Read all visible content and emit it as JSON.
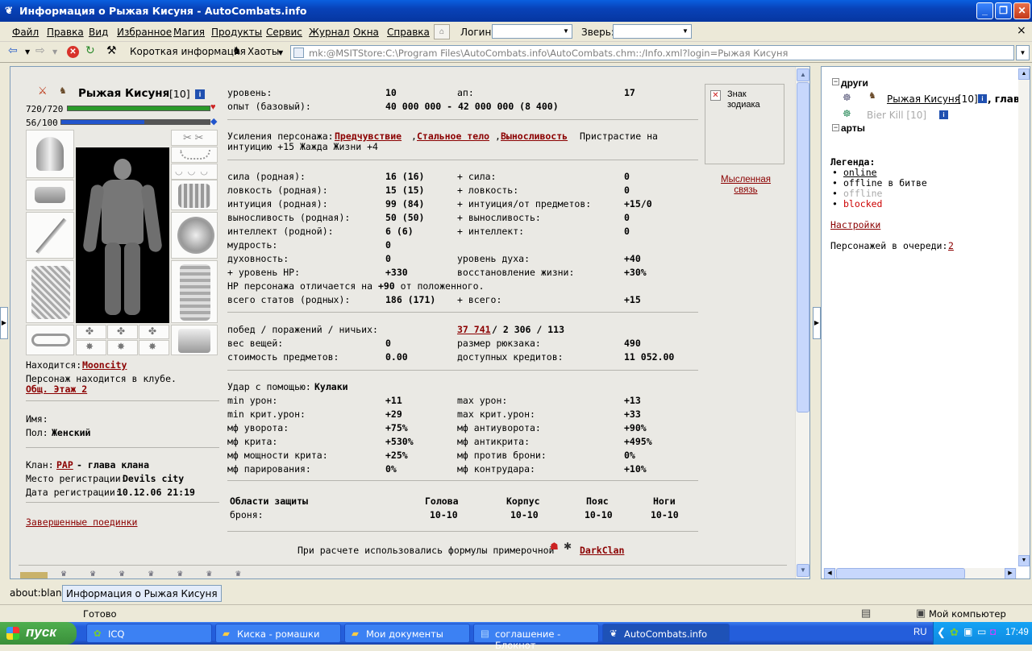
{
  "window": {
    "title": "Информация о Рыжая Кисуня - AutoCombats.info"
  },
  "menu": {
    "items": [
      "Файл",
      "Правка",
      "Вид",
      "Избранное",
      "Магия",
      "Продукты",
      "Сервис",
      "Журнал",
      "Окна",
      "Справка"
    ],
    "login_label": "Логин:",
    "beast_label": "Зверь:",
    "close": "×"
  },
  "toolbar": {
    "short_info": "Короткая информация",
    "chaos": "Хаоты"
  },
  "address": "mk:@MSITStore:C:\\Program Files\\AutoCombats.info\\AutoCombats.chm::/Info.xml?login=Рыжая Кисуня",
  "character": {
    "name": "Рыжая Кисуня",
    "level": "[10]",
    "hp": "720/720",
    "hp_fill": 1.0,
    "mana": "56/100",
    "mana_fill": 0.56,
    "location_label": "Находится:",
    "location": "Mooncity",
    "club_text": "Персонаж находится в клубе.",
    "club_link": "Общ. Этаж 2",
    "name_label": "Имя:",
    "gender_label": "Пол:",
    "gender": "Женский",
    "clan_label": "Клан:",
    "clan": "PAP",
    "clan_role": " - глава клана",
    "regplace_label": "Место регистрации:",
    "regplace": "Devils city",
    "regdate_label": "Дата регистрации:",
    "regdate": "10.12.06 21:19",
    "finished_battles": "Завершенные поединки"
  },
  "stats": {
    "level_label": "уровень:",
    "level": "10",
    "ap_label": "ап:",
    "ap": "17",
    "exp_label": "опыт (базовый):",
    "exp": "40 000 000 - 42 000 000 (8 400)",
    "boosts_label": "Усиления персонажа:",
    "boost1": "Предчувствие",
    "boost2": "Стальное тело",
    "boost3": "Выносливость",
    "boost_tail": "Пристрастие на",
    "boost_line2": "интуицию +15 Жажда Жизни +4",
    "rows": [
      {
        "l": "сила (родная):",
        "v": "16 (16)",
        "l2": "+ сила:",
        "v2": "0"
      },
      {
        "l": "ловкость (родная):",
        "v": "15 (15)",
        "l2": "+ ловкость:",
        "v2": "0"
      },
      {
        "l": "интуиция (родная):",
        "v": "99 (84)",
        "l2": "+ интуиция/от предметов:",
        "v2": "+15/0"
      },
      {
        "l": "выносливость (родная):",
        "v": "50 (50)",
        "l2": "+ выносливость:",
        "v2": "0"
      },
      {
        "l": "интеллект (родной):",
        "v": "6 (6)",
        "l2": "+ интеллект:",
        "v2": "0"
      },
      {
        "l": "мудрость:",
        "v": "0",
        "l2": "",
        "v2": ""
      },
      {
        "l": "духовность:",
        "v": "0",
        "l2": "уровень духа:",
        "v2": "+40"
      },
      {
        "l": "+ уровень HP:",
        "v": "+330",
        "l2": "восстановление жизни:",
        "v2": "+30%"
      }
    ],
    "hp_note_a": "HP персонажа отличается на",
    "hp_note_b": "+90",
    "hp_note_c": "от положенного.",
    "total_label": "всего статов (родных):",
    "total": "186 (171)",
    "total2_label": "+ всего:",
    "total2": "+15",
    "wins_label": "побед / поражений / ничьих:",
    "wins": "37 741",
    "wins_rest": " / 2 306 / 113",
    "weight_label": "вес вещей:",
    "weight": "0",
    "bag_label": "размер рюкзака:",
    "bag": "490",
    "cost_label": "стоимость предметов:",
    "cost": "0.00",
    "credits_label": "доступных кредитов:",
    "credits": "11 052.00",
    "strike_label": "Удар с помощью:",
    "strike": "Кулаки",
    "combat": [
      {
        "l": "min урон:",
        "v": "+11",
        "l2": "max урон:",
        "v2": "+13"
      },
      {
        "l": "min крит.урон:",
        "v": "+29",
        "l2": "max крит.урон:",
        "v2": "+33"
      },
      {
        "l": "мф уворота:",
        "v": "+75%",
        "l2": "мф антиуворота:",
        "v2": "+90%"
      },
      {
        "l": "мф крита:",
        "v": "+530%",
        "l2": "мф антикрита:",
        "v2": "+495%"
      },
      {
        "l": "мф мощности крита:",
        "v": "+25%",
        "l2": "мф против брони:",
        "v2": "0%"
      },
      {
        "l": "мф парирования:",
        "v": "0%",
        "l2": "мф контрудара:",
        "v2": "+10%"
      }
    ],
    "armor_title": "Области защиты",
    "armor_cols": [
      "Голова",
      "Корпус",
      "Пояс",
      "Ноги"
    ],
    "armor_label": "броня:",
    "armor_vals": [
      "10-10",
      "10-10",
      "10-10",
      "10-10"
    ],
    "formula_text": "При расчете использовались формулы примерочной",
    "formula_link": "DarkClan"
  },
  "zodiac": {
    "label": "Знак зодиака",
    "telepathy": "Мысленная связь"
  },
  "right": {
    "friends": "друзи",
    "friends_real": "други",
    "friend1": "Рыжая Кисуня",
    "friend1_level": "[10]",
    "friend1_tail": ", глав",
    "friend2": "Bier Kill [10]",
    "arts": "арты",
    "legend_title": "Легенда:",
    "legend": [
      "online",
      "offline в битве",
      "offline",
      "blocked"
    ],
    "settings": "Настройки",
    "queue_label": "Персонажей в очереди:",
    "queue": "2"
  },
  "tabs": [
    "about:blank",
    "Информация о Рыжая Кисуня"
  ],
  "status": {
    "text": "Готово",
    "computer": "Мой компьютер"
  },
  "taskbar": {
    "start": "пуск",
    "tasks": [
      "ICQ",
      "Киска - ромашки",
      "Мои документы",
      "соглашение - Блокнот",
      "AutoCombats.info"
    ],
    "lang": "RU",
    "time": "17:49"
  },
  "colors": {
    "link": "#8b0000",
    "hp": "#2a9a2a",
    "mana": "#2255cc",
    "taskbar": "#245edb"
  }
}
